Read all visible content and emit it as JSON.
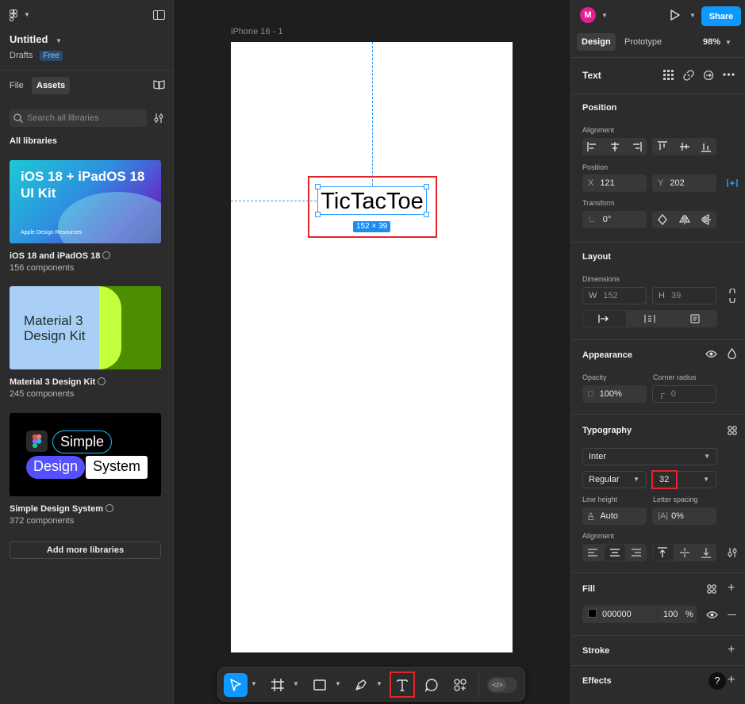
{
  "left_panel": {
    "file_title": "Untitled",
    "drafts_label": "Drafts",
    "plan_badge": "Free",
    "tabs": [
      {
        "label": "File"
      },
      {
        "label": "Assets"
      }
    ],
    "search_placeholder": "Search all libraries",
    "section_title": "All libraries",
    "libraries": [
      {
        "name": "iOS 18 and iPadOS 18",
        "count": "156 components",
        "thumb_title": "iOS 18 + iPadOS 18\nUI Kit",
        "thumb_caption": "Apple Design Resources"
      },
      {
        "name": "Material 3 Design Kit",
        "count": "245 components",
        "thumb_title": "Material 3\nDesign Kit"
      },
      {
        "name": "Simple Design System",
        "count": "372 components",
        "thumb_words": [
          "Simple",
          "Design",
          "System"
        ]
      }
    ],
    "add_button": "Add more libraries"
  },
  "canvas": {
    "frame_label": "iPhone 16 - 1",
    "text_content": "TicTacToe",
    "size_badge": "152 × 39"
  },
  "right_panel": {
    "avatar_letter": "M",
    "share_label": "Share",
    "tabs": [
      {
        "label": "Design"
      },
      {
        "label": "Prototype"
      }
    ],
    "zoom": "98%",
    "layer_type": "Text",
    "position": {
      "title": "Position",
      "alignment_label": "Alignment",
      "position_label": "Position",
      "x_label": "X",
      "x_value": "121",
      "y_label": "Y",
      "y_value": "202",
      "transform_label": "Transform",
      "rotation": "0°"
    },
    "layout": {
      "title": "Layout",
      "dimensions_label": "Dimensions",
      "w_label": "W",
      "w_value": "152",
      "h_label": "H",
      "h_value": "39"
    },
    "appearance": {
      "title": "Appearance",
      "opacity_label": "Opacity",
      "opacity_value": "100%",
      "radius_label": "Corner radius",
      "radius_value": "0"
    },
    "typography": {
      "title": "Typography",
      "font_family": "Inter",
      "font_weight": "Regular",
      "font_size": "32",
      "line_height_label": "Line height",
      "line_height_value": "Auto",
      "letter_spacing_label": "Letter spacing",
      "letter_spacing_value": "0%",
      "alignment_label": "Alignment"
    },
    "fill": {
      "title": "Fill",
      "hex": "000000",
      "opacity": "100",
      "unit": "%"
    },
    "stroke_title": "Stroke",
    "effects_title": "Effects",
    "help": "?"
  },
  "colors": {
    "accent": "#0d99ff",
    "highlight": "#e3242b",
    "avatar": "#e31f92"
  }
}
